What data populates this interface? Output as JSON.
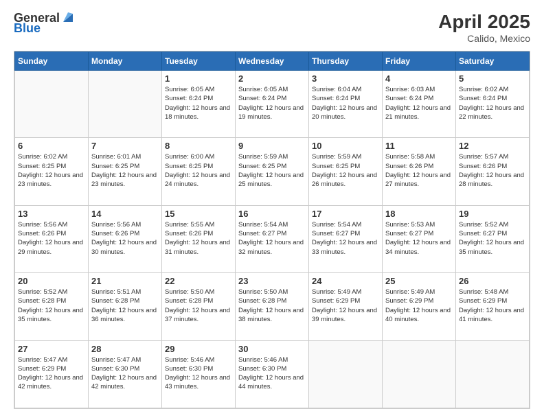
{
  "header": {
    "logo_general": "General",
    "logo_blue": "Blue",
    "main_title": "April 2025",
    "subtitle": "Calido, Mexico"
  },
  "calendar": {
    "days_of_week": [
      "Sunday",
      "Monday",
      "Tuesday",
      "Wednesday",
      "Thursday",
      "Friday",
      "Saturday"
    ],
    "weeks": [
      [
        {
          "day": "",
          "info": ""
        },
        {
          "day": "",
          "info": ""
        },
        {
          "day": "1",
          "info": "Sunrise: 6:05 AM\nSunset: 6:24 PM\nDaylight: 12 hours and 18 minutes."
        },
        {
          "day": "2",
          "info": "Sunrise: 6:05 AM\nSunset: 6:24 PM\nDaylight: 12 hours and 19 minutes."
        },
        {
          "day": "3",
          "info": "Sunrise: 6:04 AM\nSunset: 6:24 PM\nDaylight: 12 hours and 20 minutes."
        },
        {
          "day": "4",
          "info": "Sunrise: 6:03 AM\nSunset: 6:24 PM\nDaylight: 12 hours and 21 minutes."
        },
        {
          "day": "5",
          "info": "Sunrise: 6:02 AM\nSunset: 6:24 PM\nDaylight: 12 hours and 22 minutes."
        }
      ],
      [
        {
          "day": "6",
          "info": "Sunrise: 6:02 AM\nSunset: 6:25 PM\nDaylight: 12 hours and 23 minutes."
        },
        {
          "day": "7",
          "info": "Sunrise: 6:01 AM\nSunset: 6:25 PM\nDaylight: 12 hours and 23 minutes."
        },
        {
          "day": "8",
          "info": "Sunrise: 6:00 AM\nSunset: 6:25 PM\nDaylight: 12 hours and 24 minutes."
        },
        {
          "day": "9",
          "info": "Sunrise: 5:59 AM\nSunset: 6:25 PM\nDaylight: 12 hours and 25 minutes."
        },
        {
          "day": "10",
          "info": "Sunrise: 5:59 AM\nSunset: 6:25 PM\nDaylight: 12 hours and 26 minutes."
        },
        {
          "day": "11",
          "info": "Sunrise: 5:58 AM\nSunset: 6:26 PM\nDaylight: 12 hours and 27 minutes."
        },
        {
          "day": "12",
          "info": "Sunrise: 5:57 AM\nSunset: 6:26 PM\nDaylight: 12 hours and 28 minutes."
        }
      ],
      [
        {
          "day": "13",
          "info": "Sunrise: 5:56 AM\nSunset: 6:26 PM\nDaylight: 12 hours and 29 minutes."
        },
        {
          "day": "14",
          "info": "Sunrise: 5:56 AM\nSunset: 6:26 PM\nDaylight: 12 hours and 30 minutes."
        },
        {
          "day": "15",
          "info": "Sunrise: 5:55 AM\nSunset: 6:26 PM\nDaylight: 12 hours and 31 minutes."
        },
        {
          "day": "16",
          "info": "Sunrise: 5:54 AM\nSunset: 6:27 PM\nDaylight: 12 hours and 32 minutes."
        },
        {
          "day": "17",
          "info": "Sunrise: 5:54 AM\nSunset: 6:27 PM\nDaylight: 12 hours and 33 minutes."
        },
        {
          "day": "18",
          "info": "Sunrise: 5:53 AM\nSunset: 6:27 PM\nDaylight: 12 hours and 34 minutes."
        },
        {
          "day": "19",
          "info": "Sunrise: 5:52 AM\nSunset: 6:27 PM\nDaylight: 12 hours and 35 minutes."
        }
      ],
      [
        {
          "day": "20",
          "info": "Sunrise: 5:52 AM\nSunset: 6:28 PM\nDaylight: 12 hours and 35 minutes."
        },
        {
          "day": "21",
          "info": "Sunrise: 5:51 AM\nSunset: 6:28 PM\nDaylight: 12 hours and 36 minutes."
        },
        {
          "day": "22",
          "info": "Sunrise: 5:50 AM\nSunset: 6:28 PM\nDaylight: 12 hours and 37 minutes."
        },
        {
          "day": "23",
          "info": "Sunrise: 5:50 AM\nSunset: 6:28 PM\nDaylight: 12 hours and 38 minutes."
        },
        {
          "day": "24",
          "info": "Sunrise: 5:49 AM\nSunset: 6:29 PM\nDaylight: 12 hours and 39 minutes."
        },
        {
          "day": "25",
          "info": "Sunrise: 5:49 AM\nSunset: 6:29 PM\nDaylight: 12 hours and 40 minutes."
        },
        {
          "day": "26",
          "info": "Sunrise: 5:48 AM\nSunset: 6:29 PM\nDaylight: 12 hours and 41 minutes."
        }
      ],
      [
        {
          "day": "27",
          "info": "Sunrise: 5:47 AM\nSunset: 6:29 PM\nDaylight: 12 hours and 42 minutes."
        },
        {
          "day": "28",
          "info": "Sunrise: 5:47 AM\nSunset: 6:30 PM\nDaylight: 12 hours and 42 minutes."
        },
        {
          "day": "29",
          "info": "Sunrise: 5:46 AM\nSunset: 6:30 PM\nDaylight: 12 hours and 43 minutes."
        },
        {
          "day": "30",
          "info": "Sunrise: 5:46 AM\nSunset: 6:30 PM\nDaylight: 12 hours and 44 minutes."
        },
        {
          "day": "",
          "info": ""
        },
        {
          "day": "",
          "info": ""
        },
        {
          "day": "",
          "info": ""
        }
      ]
    ]
  }
}
